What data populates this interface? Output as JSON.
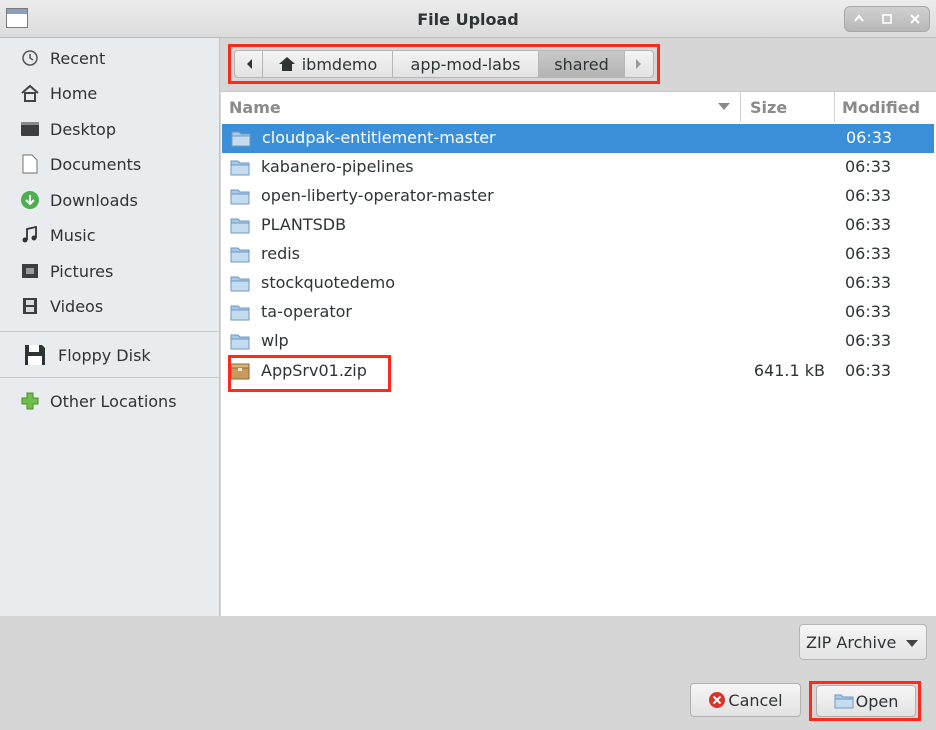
{
  "window": {
    "title": "File Upload"
  },
  "sidebar": {
    "items": [
      {
        "label": "Recent",
        "icon": "clock-icon"
      },
      {
        "label": "Home",
        "icon": "home-icon"
      },
      {
        "label": "Desktop",
        "icon": "desktop-icon"
      },
      {
        "label": "Documents",
        "icon": "document-icon"
      },
      {
        "label": "Downloads",
        "icon": "download-icon"
      },
      {
        "label": "Music",
        "icon": "music-icon"
      },
      {
        "label": "Pictures",
        "icon": "picture-icon"
      },
      {
        "label": "Videos",
        "icon": "film-icon"
      }
    ],
    "devices": [
      {
        "label": "Floppy Disk",
        "icon": "floppy-icon"
      }
    ],
    "other": [
      {
        "label": "Other Locations",
        "icon": "plus-icon"
      }
    ]
  },
  "pathbar": {
    "segments": [
      "ibmdemo",
      "app-mod-labs",
      "shared"
    ],
    "active": "shared"
  },
  "columns": {
    "name": "Name",
    "size": "Size",
    "modified": "Modified"
  },
  "files": [
    {
      "name": "cloudpak-entitlement-master",
      "size": "",
      "modified": "06:33",
      "type": "folder",
      "selected": true
    },
    {
      "name": "kabanero-pipelines",
      "size": "",
      "modified": "06:33",
      "type": "folder"
    },
    {
      "name": "open-liberty-operator-master",
      "size": "",
      "modified": "06:33",
      "type": "folder"
    },
    {
      "name": "PLANTSDB",
      "size": "",
      "modified": "06:33",
      "type": "folder"
    },
    {
      "name": "redis",
      "size": "",
      "modified": "06:33",
      "type": "folder"
    },
    {
      "name": "stockquotedemo",
      "size": "",
      "modified": "06:33",
      "type": "folder"
    },
    {
      "name": "ta-operator",
      "size": "",
      "modified": "06:33",
      "type": "folder"
    },
    {
      "name": "wlp",
      "size": "",
      "modified": "06:33",
      "type": "folder"
    },
    {
      "name": "AppSrv01.zip",
      "size": "641.1 kB",
      "modified": "06:33",
      "type": "archive"
    }
  ],
  "filter": {
    "selected": "ZIP Archive"
  },
  "buttons": {
    "cancel": "Cancel",
    "open": "Open"
  },
  "colors": {
    "selection": "#3b8fd8",
    "highlight": "#ff2a17"
  }
}
